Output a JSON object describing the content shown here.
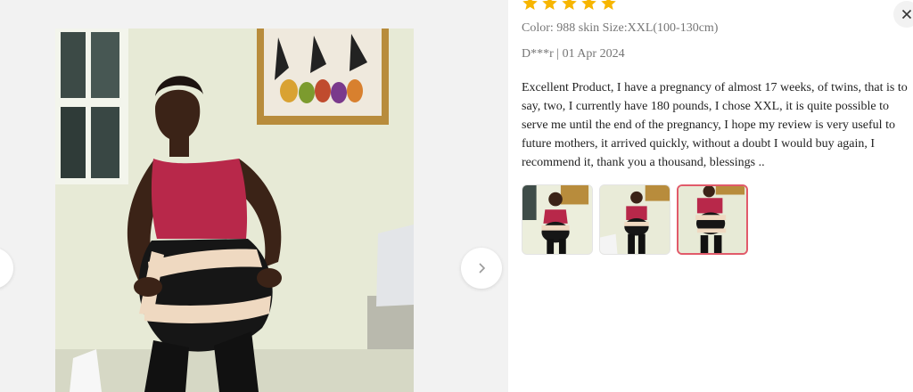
{
  "review": {
    "rating": 5,
    "sku_info": "Color: 988 skin Size:XXL(100-130cm)",
    "meta": "D***r | 01 Apr 2024",
    "text": "Excellent Product, I have a pregnancy of almost 17 weeks, of twins, that is to say, two, I currently have 180 pounds, I chose XXL, it is quite possible to serve me until the end of the pregnancy, I hope my review is very useful to future mothers, it arrived quickly, without a doubt I would buy again, I recommend it, thank you a thousand, blessings .."
  },
  "thumbnails": {
    "count": 3,
    "active_index": 2
  },
  "icons": {
    "star": "star-icon",
    "close": "close-icon",
    "prev": "chevron-left-icon",
    "next": "chevron-right-icon"
  },
  "colors": {
    "star": "#f7b500",
    "active_border": "#e15a6a",
    "secondary_text": "#767676",
    "body_text": "#222222"
  }
}
